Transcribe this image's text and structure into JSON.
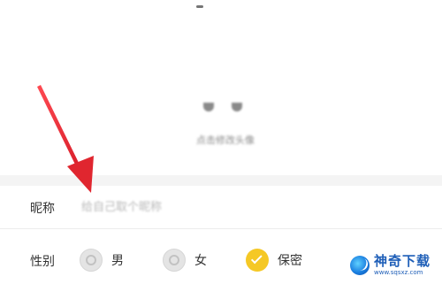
{
  "profile": {
    "change_avatar_label": "点击修改头像"
  },
  "nickname": {
    "label": "昵称",
    "placeholder": "给自己取个昵称"
  },
  "gender": {
    "label": "性别",
    "options": [
      {
        "label": "男",
        "icon": "male-radio-icon",
        "selected": false
      },
      {
        "label": "女",
        "icon": "female-radio-icon",
        "selected": false
      },
      {
        "label": "保密",
        "icon": "secret-check-icon",
        "selected": true
      }
    ]
  },
  "annotation": {
    "arrow_color": "#e8323c"
  },
  "watermark": {
    "title": "神奇下载",
    "url": "www.sqsxz.com"
  },
  "colors": {
    "accent_yellow": "#f5c825",
    "label_text": "#333333",
    "placeholder_text": "#b8b8b8"
  }
}
